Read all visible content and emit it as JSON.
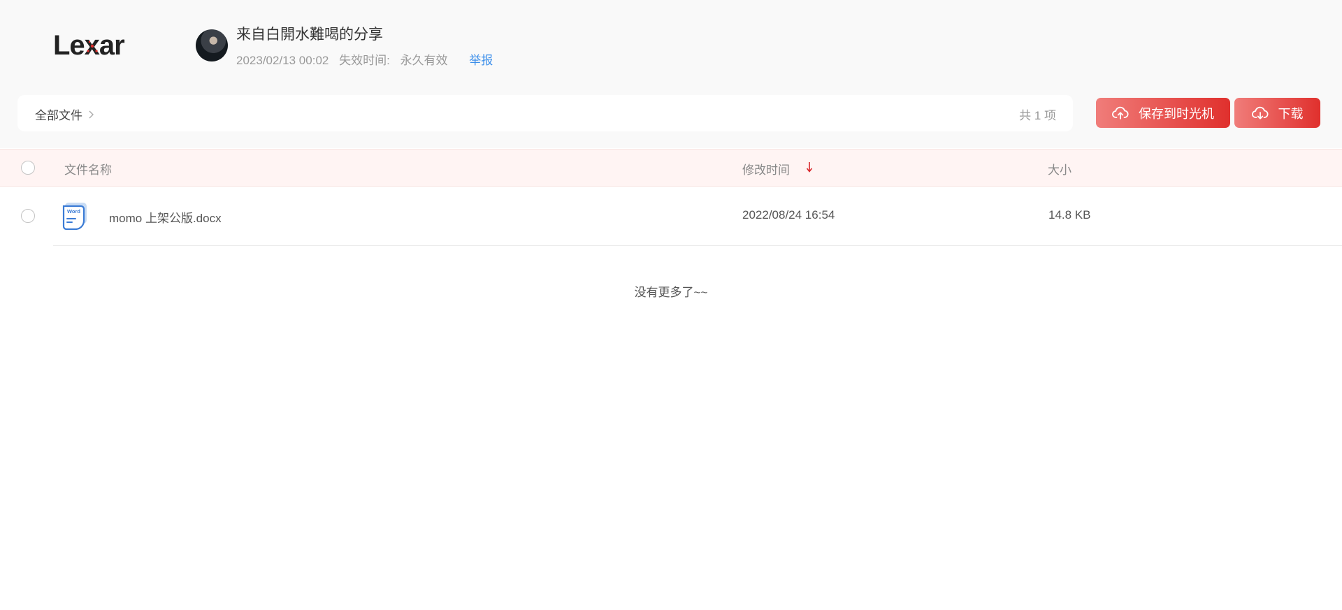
{
  "brand": {
    "logo_text": "Lexar",
    "accent_color": "#e0302d"
  },
  "share": {
    "title": "来自白開水難喝的分享",
    "created_at": "2023/02/13 00:02",
    "expire_label": "失效时间:",
    "expire_value": "永久有效",
    "report_label": "举报"
  },
  "breadcrumb": {
    "root_label": "全部文件",
    "chevron_icon": "chevron-right-icon"
  },
  "summary": {
    "total_label": "共 1 项"
  },
  "actions": {
    "save_label": "保存到时光机",
    "save_icon": "cloud-upload-icon",
    "download_label": "下载",
    "download_icon": "cloud-download-icon"
  },
  "table": {
    "columns": {
      "name": "文件名称",
      "modified": "修改时间",
      "size": "大小"
    },
    "sort": {
      "column": "modified",
      "direction": "desc",
      "icon": "arrow-down-icon"
    },
    "rows": [
      {
        "icon": "word-document-icon",
        "icon_label": "Word",
        "name": "momo 上架公版.docx",
        "modified": "2022/08/24 16:54",
        "size": "14.8 KB"
      }
    ],
    "empty_footer": "没有更多了~~"
  }
}
